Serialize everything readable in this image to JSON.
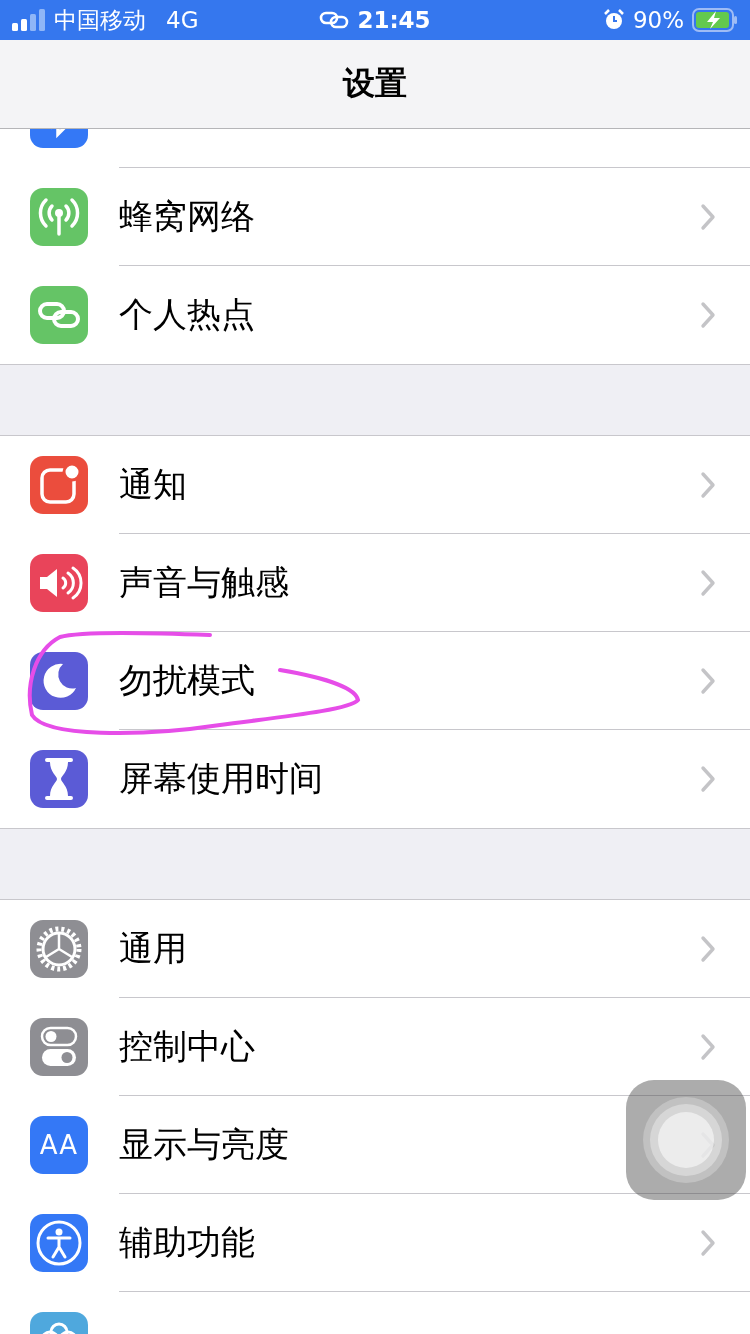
{
  "status_bar": {
    "carrier": "中国移动",
    "network": "4G",
    "time": "21:45",
    "battery": "90%"
  },
  "nav": {
    "title": "设置"
  },
  "groups": [
    {
      "rows": [
        {
          "kind": "bluetooth",
          "color": "#3478f6"
        },
        {
          "kind": "cellular",
          "color": "#65c466",
          "label": "蜂窝网络"
        },
        {
          "kind": "hotspot",
          "color": "#65c466",
          "label": "个人热点"
        }
      ]
    },
    {
      "rows": [
        {
          "kind": "notifications",
          "color": "#eb4d3d",
          "label": "通知"
        },
        {
          "kind": "sounds",
          "color": "#e9445a",
          "label": "声音与触感"
        },
        {
          "kind": "moon",
          "color": "#5b5bd6",
          "label": "勿扰模式"
        },
        {
          "kind": "hourglass",
          "color": "#5b5bd6",
          "label": "屏幕使用时间"
        }
      ]
    },
    {
      "rows": [
        {
          "kind": "gear",
          "color": "#8e8e93",
          "label": "通用"
        },
        {
          "kind": "toggles",
          "color": "#8e8e93",
          "label": "控制中心"
        },
        {
          "kind": "letters",
          "icon_text": "AA",
          "color": "#3478f6",
          "label": "显示与亮度"
        },
        {
          "kind": "accessibility",
          "color": "#3478f6",
          "label": "辅助功能"
        },
        {
          "kind": "flower",
          "color": "#4fa8dd"
        }
      ]
    }
  ]
}
